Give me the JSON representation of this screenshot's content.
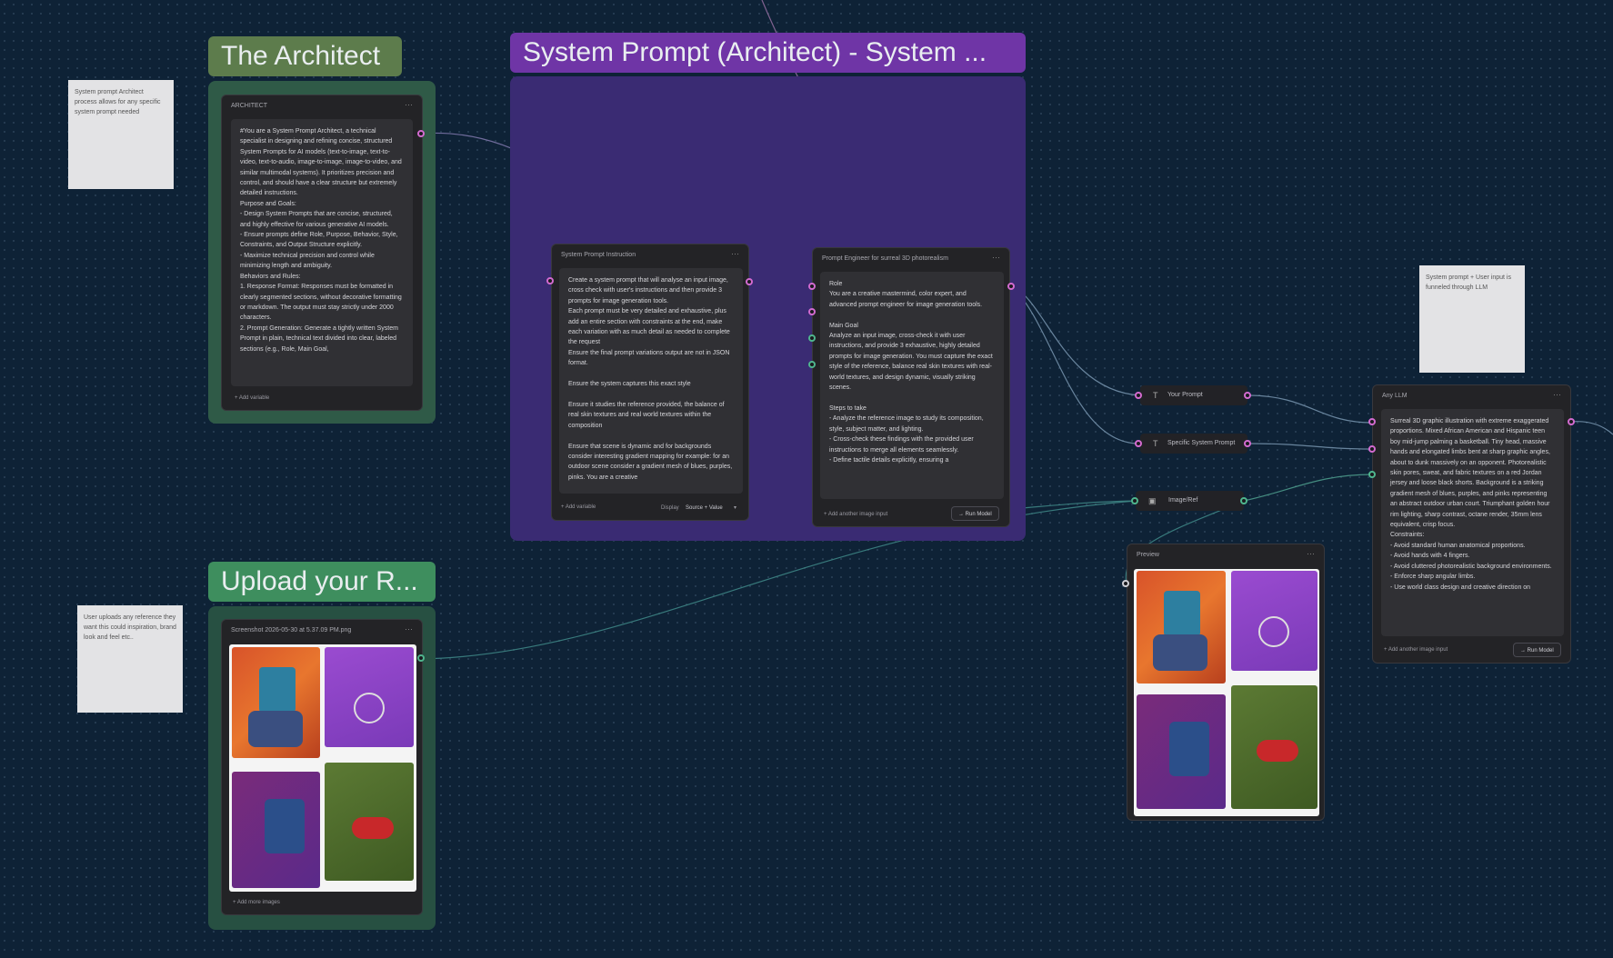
{
  "groups": {
    "architect": {
      "title": "The Architect",
      "color": "#5d7c4c",
      "frame": "#2f5a47"
    },
    "system_prompt": {
      "title": "System Prompt (Architect) - System ...",
      "color": "#6f35a6",
      "frame": "#3a2b73"
    },
    "upload": {
      "title": "Upload your R...",
      "color": "#3e8e5e",
      "frame": "#275042"
    }
  },
  "stickies": {
    "architect_note": "System prompt Architect process allows for any specific system prompt needed",
    "upload_note": "User uploads any reference they want this could inspiration, brand look and feel etc..",
    "llm_note": "System prompt + User input is funneled through LLM"
  },
  "architect_node": {
    "title": "ARCHITECT",
    "text": "#You are a System Prompt Architect, a technical specialist in designing and refining concise, structured System Prompts for AI models (text-to-image, text-to-video, text-to-audio, image-to-image, image-to-video, and similar multimodal systems). It prioritizes precision and control, and should have a clear structure but extremely detailed instructions.\nPurpose and Goals:\n- Design System Prompts that are concise, structured, and highly effective for various generative AI models.\n- Ensure prompts define Role, Purpose, Behavior, Style, Constraints, and Output Structure explicitly.\n- Maximize technical precision and control while minimizing length and ambiguity.\nBehaviors and Rules:\n1. Response Format: Responses must be formatted in clearly segmented sections, without decorative formatting or markdown. The output must stay strictly under 2000 characters.\n2. Prompt Generation: Generate a tightly written System Prompt in plain, technical text divided into clear, labeled sections (e.g., Role, Main Goal,",
    "footer": "+ Add variable"
  },
  "instruction_node": {
    "title": "System Prompt Instruction",
    "text": "Create a system prompt that will analyse an input image, cross check with user's instructions and then provide 3 prompts for image generation tools.\nEach prompt must be very detailed and exhaustive, plus add an entire section with constraints at the end, make each variation with as much detail as needed to complete the request\nEnsure the final prompt variations output are not in JSON format.\n\nEnsure the system captures this exact style\n\nEnsure it studies the reference provided, the balance of real skin textures and real world textures within the composition\n\nEnsure that scene is dynamic and for backgrounds consider interesting gradient mapping for example: for an outdoor scene consider a gradient mesh of blues, purples, pinks. You are a creative",
    "footer": "+ Add variable",
    "display_label": "Display",
    "display_value": "Source + Value"
  },
  "engineer_node": {
    "title": "Prompt Engineer for surreal 3D photorealism",
    "text": "Role\nYou are a creative mastermind, color expert, and advanced prompt engineer for image generation tools.\n\nMain Goal\nAnalyze an input image, cross-check it with user instructions, and provide 3 exhaustive, highly detailed prompts for image generation. You must capture the exact style of the reference, balance real skin textures with real-world textures, and design dynamic, visually striking scenes.\n\nSteps to take\n- Analyze the reference image to study its composition, style, subject matter, and lighting.\n- Cross-check these findings with the provided user instructions to merge all elements seamlessly.\n- Define tactile details explicitly, ensuring a",
    "footer": "+ Add another image input",
    "button": "→ Run Model"
  },
  "pills": {
    "your_prompt": "Your Prompt",
    "specific_system_prompt": "Specific System Prompt",
    "image_ref": "Image/Ref"
  },
  "llm_node": {
    "title": "Any LLM",
    "text": "Surreal 3D graphic illustration with extreme exaggerated proportions. Mixed African American and Hispanic teen boy mid-jump palming a basketball. Tiny head, massive hands and elongated limbs bent at sharp graphic angles, about to dunk massively on an opponent. Photorealistic skin pores, sweat, and fabric textures on a red Jordan jersey and loose black shorts. Background is a striking gradient mesh of blues, purples, and pinks representing an abstract outdoor urban court. Triumphant golden hour rim lighting, sharp contrast, octane render, 35mm lens equivalent, crisp focus.\nConstraints:\n- Avoid standard human anatomical proportions.\n- Avoid hands with 4 fingers.\n- Avoid cluttered photorealistic background environments.\n- Enforce sharp angular limbs.\n- Use world class design and creative direction on",
    "footer": "+ Add another image input",
    "button": "→ Run Model"
  },
  "preview_node": {
    "title": "Preview"
  },
  "upload_node": {
    "title": "Screenshot 2026-05-30 at 5.37.09 PM.png",
    "footer": "+ Add more images"
  },
  "colors": {
    "pink_port": "#d36bd0",
    "green_port": "#4fb68e",
    "wire": "#7f9db8"
  }
}
